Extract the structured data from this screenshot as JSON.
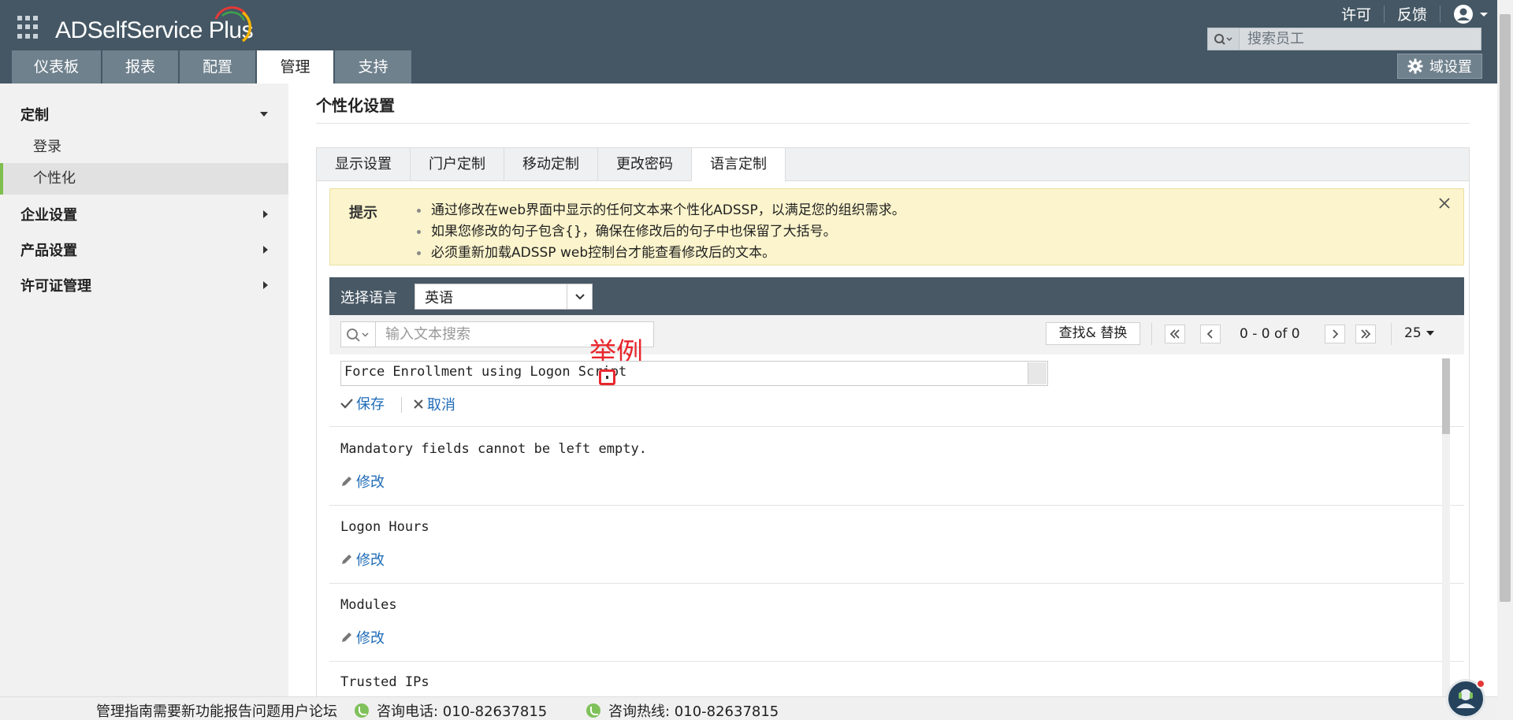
{
  "app": {
    "logo_text": "ADSelfService Plus",
    "links": {
      "license": "许可",
      "feedback": "反馈"
    },
    "search_placeholder": "搜索员工",
    "nav_tabs": [
      "仪表板",
      "报表",
      "配置",
      "管理",
      "支持"
    ],
    "active_tab": "管理",
    "domain_settings": "域设置"
  },
  "sidebar": {
    "customize": {
      "label": "定制",
      "items": [
        "登录",
        "个性化"
      ],
      "active": "个性化"
    },
    "sections": [
      "企业设置",
      "产品设置",
      "许可证管理"
    ]
  },
  "main": {
    "page_title": "个性化设置",
    "sub_tabs": [
      "显示设置",
      "门户定制",
      "移动定制",
      "更改密码",
      "语言定制"
    ],
    "active_sub_tab": "语言定制",
    "tip": {
      "label": "提示",
      "items": [
        "通过修改在web界面中显示的任何文本来个性化ADSSP，以满足您的组织需求。",
        "如果您修改的句子包含{}，确保在修改后的句子中也保留了大括号。",
        "必须重新加载ADSSP web控制台才能查看修改后的文本。"
      ]
    },
    "language": {
      "label": "选择语言",
      "selected": "英语"
    },
    "toolbar": {
      "search_placeholder": "输入文本搜索",
      "find_replace": "查找& 替换",
      "page_info": "0 - 0 of 0",
      "per_page": "25"
    },
    "annotation": "举例",
    "editing_row": {
      "value": "Force Enrollment using Logon Script",
      "save": "保存",
      "cancel": "取消"
    },
    "rows": [
      {
        "text": "Mandatory fields cannot be left empty.",
        "action": "修改"
      },
      {
        "text": "Logon Hours",
        "action": "修改"
      },
      {
        "text": "Modules",
        "action": "修改"
      },
      {
        "text": "Trusted IPs",
        "action": ""
      }
    ]
  },
  "footer": {
    "links": "管理指南需要新功能报告问题用户论坛",
    "phone1": "咨询电话: 010-82637815",
    "phone2": "咨询热线: 010-82637815"
  },
  "colors": {
    "header": "#455764",
    "nav_tab": "#6f818d",
    "accent_link": "#1e6bb8",
    "tip_bg": "#fbf4cc",
    "annotation_red": "#e8262d",
    "active_marker": "#7fbf4d"
  }
}
